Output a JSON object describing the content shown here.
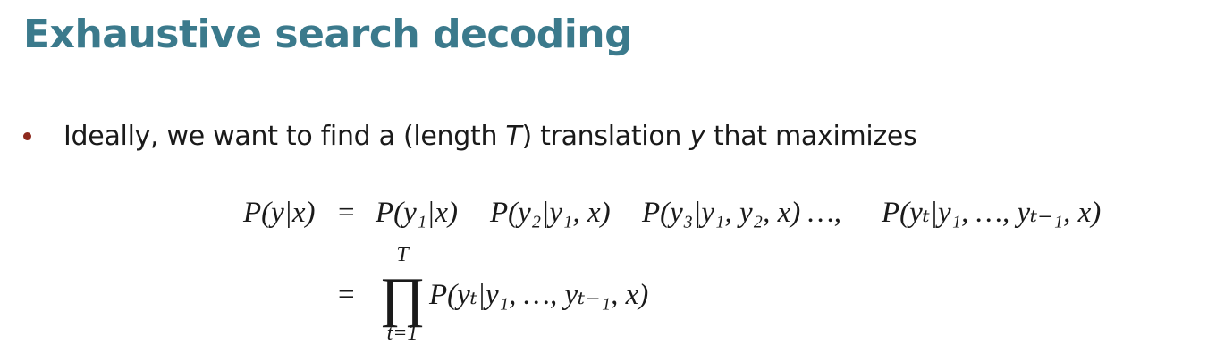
{
  "slide": {
    "title": "Exhaustive search decoding",
    "bullet": {
      "text_before": "Ideally, we want to find a (length ",
      "var_T": "T",
      "text_middle": ") translation ",
      "var_y": "y",
      "text_after": " that maximizes"
    }
  },
  "equation": {
    "line1_lhs": "P(y|x)",
    "equals": "=",
    "term1": "P(y₁|x)",
    "term2": "P(y₂|y₁, x)",
    "term3": "P(y₃|y₁, y₂, x) …,",
    "term4": "P(yₜ|y₁, …, yₜ₋₁, x)",
    "product_symbol": "∏",
    "product_upper": "T",
    "product_lower": "t=1",
    "line2_term": "P(yₜ|y₁, …, yₜ₋₁, x)"
  },
  "colors": {
    "title": "#3b7a8c",
    "bullet": "#8e2a1e",
    "text": "#1a1a1a"
  }
}
